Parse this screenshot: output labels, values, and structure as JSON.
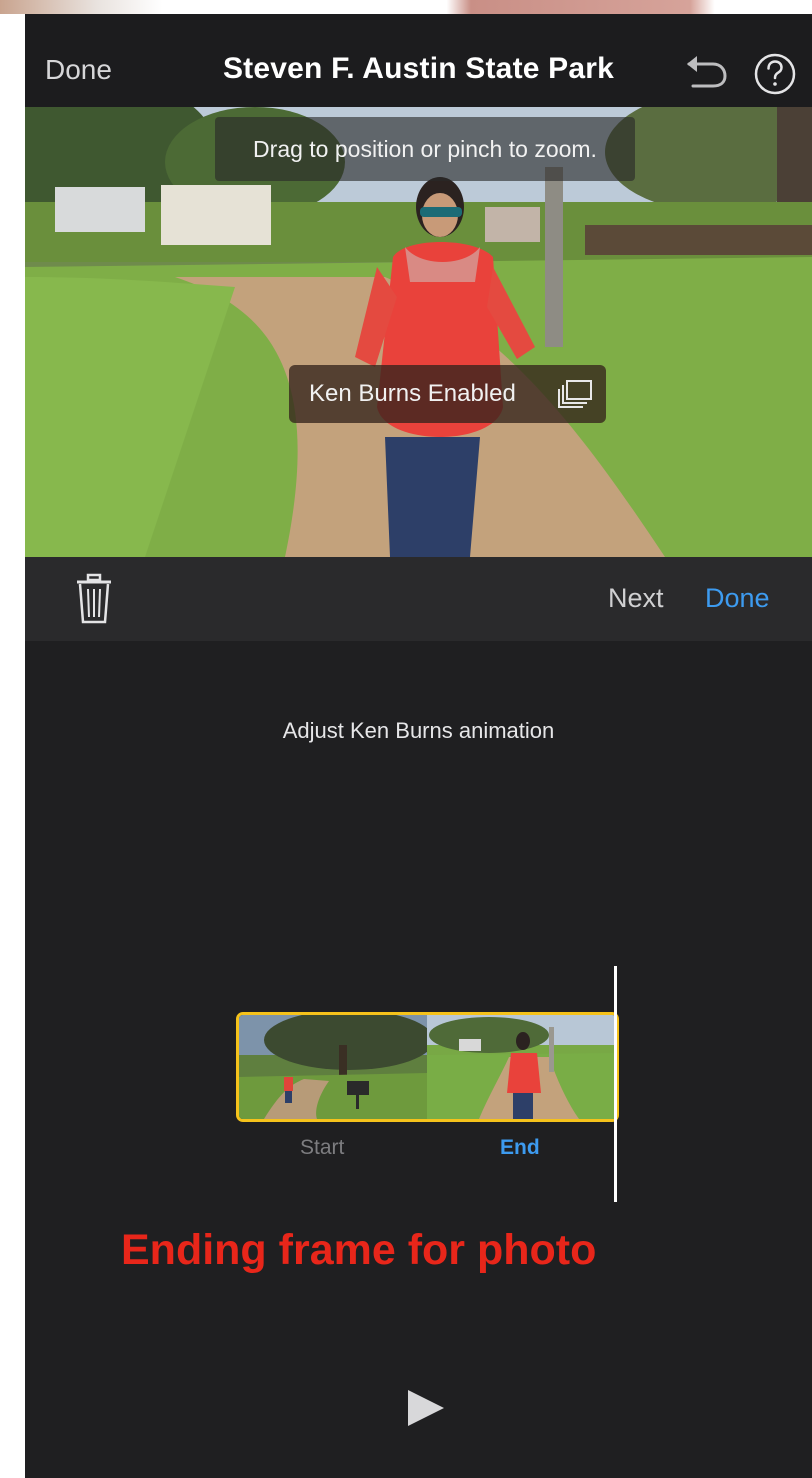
{
  "nav": {
    "done_label": "Done",
    "title": "Steven F. Austin State Park",
    "undo_icon": "undo-arrow-icon",
    "help_icon": "question-mark-circle-icon"
  },
  "preview": {
    "hint": "Drag to position or pinch to zoom.",
    "ken_burns_label": "Ken Burns Enabled",
    "ken_burns_icon": "stacked-frames-icon"
  },
  "toolbar": {
    "trash_icon": "trash-icon",
    "next_label": "Next",
    "done_label": "Done"
  },
  "editor": {
    "instruction": "Adjust Ken Burns animation",
    "start_label": "Start",
    "end_label": "End",
    "annotation": "Ending frame for photo",
    "play_icon": "play-icon"
  },
  "colors": {
    "accent_blue": "#3d9bf0",
    "filmstrip_border": "#f5c21b",
    "annotation_red": "#e8261a",
    "background": "#1f1f21"
  }
}
